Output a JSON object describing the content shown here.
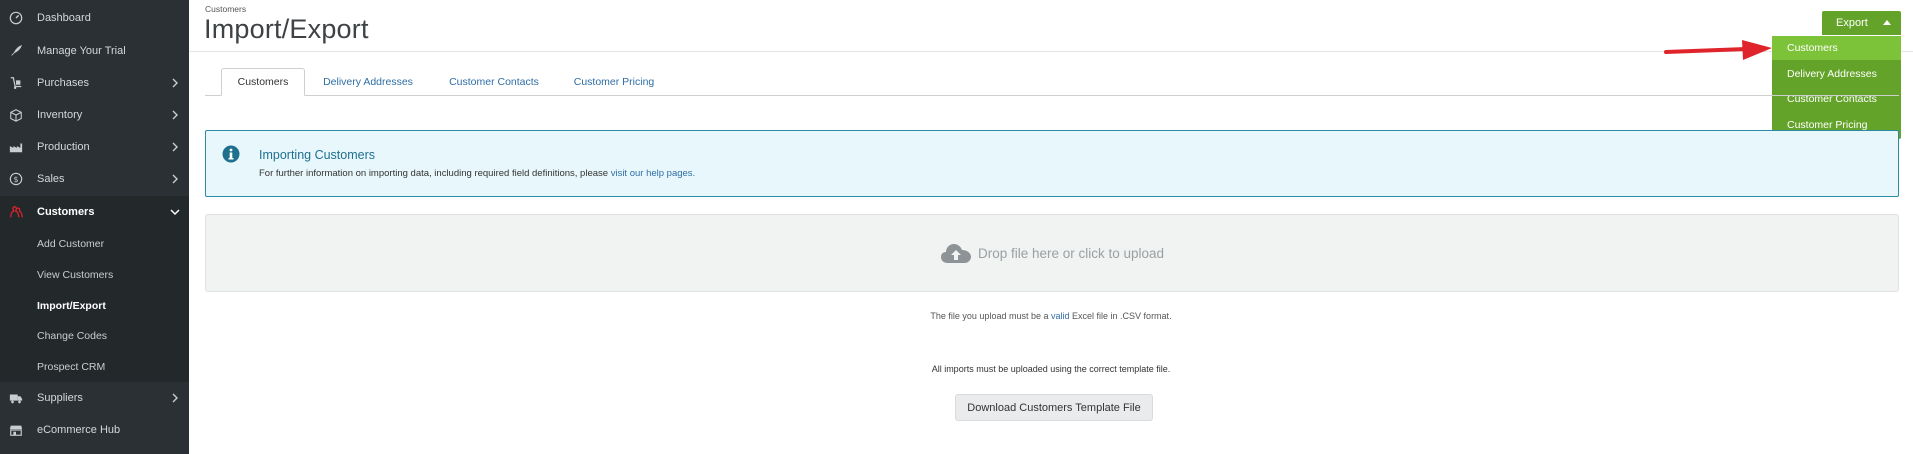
{
  "sidebar": {
    "items": [
      {
        "label": "Dashboard",
        "icon": "dashboard-icon"
      },
      {
        "label": "Manage Your Trial",
        "icon": "rocket-icon"
      },
      {
        "label": "Purchases",
        "icon": "dolly-icon"
      },
      {
        "label": "Inventory",
        "icon": "box-icon"
      },
      {
        "label": "Production",
        "icon": "factory-icon"
      },
      {
        "label": "Sales",
        "icon": "dollar-icon"
      },
      {
        "label": "Customers",
        "icon": "customers-icon"
      },
      {
        "label": "Suppliers",
        "icon": "truck-icon"
      },
      {
        "label": "eCommerce Hub",
        "icon": "store-icon"
      }
    ],
    "customers_submenu": [
      {
        "label": "Add Customer"
      },
      {
        "label": "View Customers"
      },
      {
        "label": "Import/Export"
      },
      {
        "label": "Change Codes"
      },
      {
        "label": "Prospect CRM"
      }
    ]
  },
  "header": {
    "breadcrumb": "Customers",
    "title": "Import/Export"
  },
  "export": {
    "button_label": "Export",
    "menu_items": [
      "Customers",
      "Delivery Addresses",
      "Customer Contacts",
      "Customer Pricing"
    ]
  },
  "tabs": [
    "Customers",
    "Delivery Addresses",
    "Customer Contacts",
    "Customer Pricing"
  ],
  "info": {
    "title": "Importing Customers",
    "text": "For further information on importing data, including required field definitions, please",
    "link": "visit our help pages."
  },
  "dropzone": {
    "text": "Drop file here or click to upload"
  },
  "note_file": {
    "before": "The file you upload must be a",
    "link": "valid",
    "after": "Excel file in .CSV format."
  },
  "note_template": "All imports must be uploaded using the correct template file.",
  "download_button": "Download Customers Template File",
  "colors": {
    "sidebar": "#2b3034",
    "accent_green": "#64a329",
    "highlight_green": "#7dc33a",
    "info_border": "#2b8aa4",
    "annotation_arrow": "#e0242c"
  }
}
